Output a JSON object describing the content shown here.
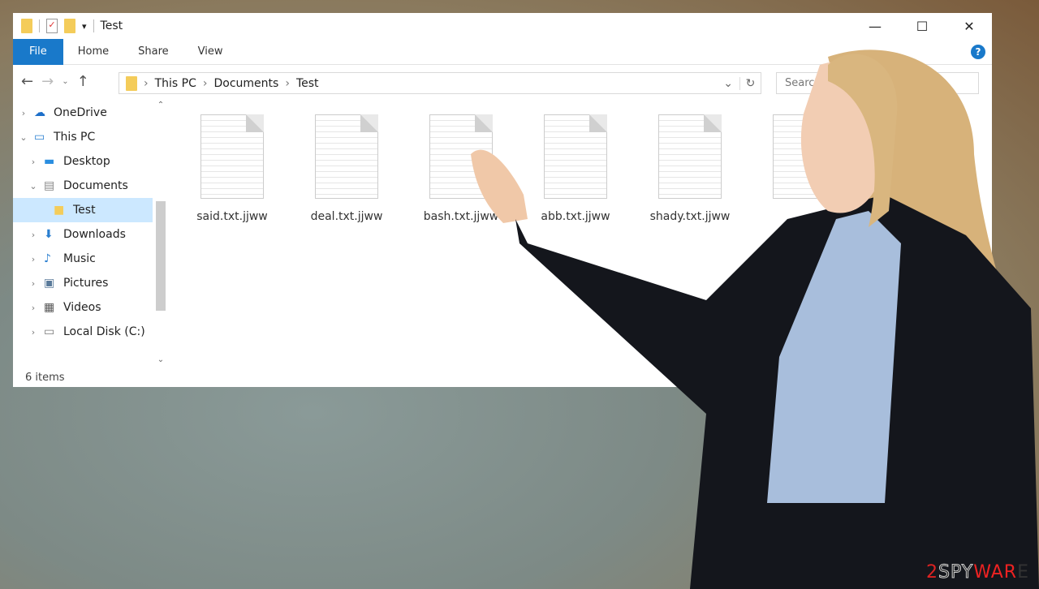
{
  "window": {
    "title": "Test",
    "minimize": "—",
    "maximize": "☐",
    "close": "✕"
  },
  "ribbon": {
    "tabs": [
      "File",
      "Home",
      "Share",
      "View"
    ]
  },
  "address": {
    "crumbs": [
      "This PC",
      "Documents",
      "Test"
    ],
    "search_placeholder": "Search"
  },
  "nav": [
    {
      "label": "OneDrive",
      "icon": "cloud-icon",
      "expanded": false
    },
    {
      "label": "This PC",
      "icon": "computer-icon",
      "expanded": true
    },
    {
      "label": "Desktop",
      "icon": "desktop-icon"
    },
    {
      "label": "Documents",
      "icon": "documents-icon",
      "expanded": true
    },
    {
      "label": "Test",
      "icon": "folder-icon",
      "selected": true
    },
    {
      "label": "Downloads",
      "icon": "download-icon"
    },
    {
      "label": "Music",
      "icon": "music-icon"
    },
    {
      "label": "Pictures",
      "icon": "pictures-icon"
    },
    {
      "label": "Videos",
      "icon": "videos-icon"
    },
    {
      "label": "Local Disk (C:)",
      "icon": "disk-icon"
    }
  ],
  "files": [
    "said.txt.jjww",
    "deal.txt.jjww",
    "bash.txt.jjww",
    "abb.txt.jjww",
    "shady.txt.jjww",
    ""
  ],
  "status": "6 items",
  "watermark": {
    "a": "2",
    "b": "SPY",
    "c": "WAR",
    "d": "E"
  },
  "colors": {
    "accent": "#1979ca",
    "selected": "#cce8ff"
  }
}
